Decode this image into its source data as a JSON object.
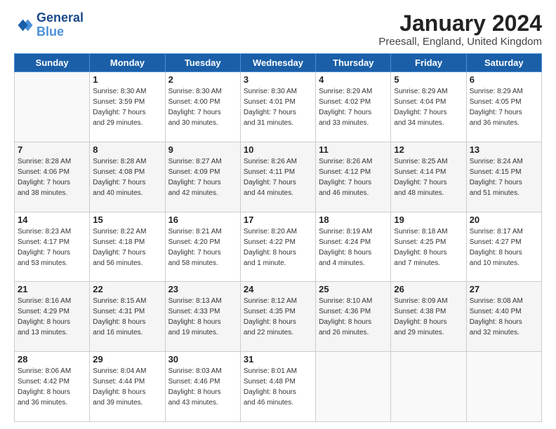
{
  "header": {
    "logo_line1": "General",
    "logo_line2": "Blue",
    "month": "January 2024",
    "location": "Preesall, England, United Kingdom"
  },
  "weekdays": [
    "Sunday",
    "Monday",
    "Tuesday",
    "Wednesday",
    "Thursday",
    "Friday",
    "Saturday"
  ],
  "weeks": [
    [
      {
        "day": "",
        "info": ""
      },
      {
        "day": "1",
        "info": "Sunrise: 8:30 AM\nSunset: 3:59 PM\nDaylight: 7 hours\nand 29 minutes."
      },
      {
        "day": "2",
        "info": "Sunrise: 8:30 AM\nSunset: 4:00 PM\nDaylight: 7 hours\nand 30 minutes."
      },
      {
        "day": "3",
        "info": "Sunrise: 8:30 AM\nSunset: 4:01 PM\nDaylight: 7 hours\nand 31 minutes."
      },
      {
        "day": "4",
        "info": "Sunrise: 8:29 AM\nSunset: 4:02 PM\nDaylight: 7 hours\nand 33 minutes."
      },
      {
        "day": "5",
        "info": "Sunrise: 8:29 AM\nSunset: 4:04 PM\nDaylight: 7 hours\nand 34 minutes."
      },
      {
        "day": "6",
        "info": "Sunrise: 8:29 AM\nSunset: 4:05 PM\nDaylight: 7 hours\nand 36 minutes."
      }
    ],
    [
      {
        "day": "7",
        "info": "Sunrise: 8:28 AM\nSunset: 4:06 PM\nDaylight: 7 hours\nand 38 minutes."
      },
      {
        "day": "8",
        "info": "Sunrise: 8:28 AM\nSunset: 4:08 PM\nDaylight: 7 hours\nand 40 minutes."
      },
      {
        "day": "9",
        "info": "Sunrise: 8:27 AM\nSunset: 4:09 PM\nDaylight: 7 hours\nand 42 minutes."
      },
      {
        "day": "10",
        "info": "Sunrise: 8:26 AM\nSunset: 4:11 PM\nDaylight: 7 hours\nand 44 minutes."
      },
      {
        "day": "11",
        "info": "Sunrise: 8:26 AM\nSunset: 4:12 PM\nDaylight: 7 hours\nand 46 minutes."
      },
      {
        "day": "12",
        "info": "Sunrise: 8:25 AM\nSunset: 4:14 PM\nDaylight: 7 hours\nand 48 minutes."
      },
      {
        "day": "13",
        "info": "Sunrise: 8:24 AM\nSunset: 4:15 PM\nDaylight: 7 hours\nand 51 minutes."
      }
    ],
    [
      {
        "day": "14",
        "info": "Sunrise: 8:23 AM\nSunset: 4:17 PM\nDaylight: 7 hours\nand 53 minutes."
      },
      {
        "day": "15",
        "info": "Sunrise: 8:22 AM\nSunset: 4:18 PM\nDaylight: 7 hours\nand 56 minutes."
      },
      {
        "day": "16",
        "info": "Sunrise: 8:21 AM\nSunset: 4:20 PM\nDaylight: 7 hours\nand 58 minutes."
      },
      {
        "day": "17",
        "info": "Sunrise: 8:20 AM\nSunset: 4:22 PM\nDaylight: 8 hours\nand 1 minute."
      },
      {
        "day": "18",
        "info": "Sunrise: 8:19 AM\nSunset: 4:24 PM\nDaylight: 8 hours\nand 4 minutes."
      },
      {
        "day": "19",
        "info": "Sunrise: 8:18 AM\nSunset: 4:25 PM\nDaylight: 8 hours\nand 7 minutes."
      },
      {
        "day": "20",
        "info": "Sunrise: 8:17 AM\nSunset: 4:27 PM\nDaylight: 8 hours\nand 10 minutes."
      }
    ],
    [
      {
        "day": "21",
        "info": "Sunrise: 8:16 AM\nSunset: 4:29 PM\nDaylight: 8 hours\nand 13 minutes."
      },
      {
        "day": "22",
        "info": "Sunrise: 8:15 AM\nSunset: 4:31 PM\nDaylight: 8 hours\nand 16 minutes."
      },
      {
        "day": "23",
        "info": "Sunrise: 8:13 AM\nSunset: 4:33 PM\nDaylight: 8 hours\nand 19 minutes."
      },
      {
        "day": "24",
        "info": "Sunrise: 8:12 AM\nSunset: 4:35 PM\nDaylight: 8 hours\nand 22 minutes."
      },
      {
        "day": "25",
        "info": "Sunrise: 8:10 AM\nSunset: 4:36 PM\nDaylight: 8 hours\nand 26 minutes."
      },
      {
        "day": "26",
        "info": "Sunrise: 8:09 AM\nSunset: 4:38 PM\nDaylight: 8 hours\nand 29 minutes."
      },
      {
        "day": "27",
        "info": "Sunrise: 8:08 AM\nSunset: 4:40 PM\nDaylight: 8 hours\nand 32 minutes."
      }
    ],
    [
      {
        "day": "28",
        "info": "Sunrise: 8:06 AM\nSunset: 4:42 PM\nDaylight: 8 hours\nand 36 minutes."
      },
      {
        "day": "29",
        "info": "Sunrise: 8:04 AM\nSunset: 4:44 PM\nDaylight: 8 hours\nand 39 minutes."
      },
      {
        "day": "30",
        "info": "Sunrise: 8:03 AM\nSunset: 4:46 PM\nDaylight: 8 hours\nand 43 minutes."
      },
      {
        "day": "31",
        "info": "Sunrise: 8:01 AM\nSunset: 4:48 PM\nDaylight: 8 hours\nand 46 minutes."
      },
      {
        "day": "",
        "info": ""
      },
      {
        "day": "",
        "info": ""
      },
      {
        "day": "",
        "info": ""
      }
    ]
  ]
}
